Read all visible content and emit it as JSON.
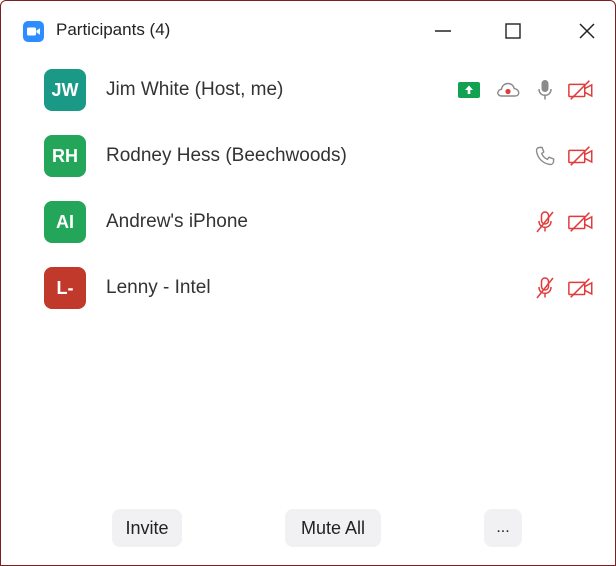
{
  "window": {
    "title": "Participants (4)",
    "app_icon": "zoom-camera-icon",
    "controls": [
      "minimize-icon",
      "maximize-icon",
      "close-icon"
    ]
  },
  "participants": [
    {
      "initials": "JW",
      "name": "Jim White (Host, me)",
      "avatar_color": "#1a9a86",
      "icons": [
        "share-screen-icon",
        "cloud-record-icon",
        "mic-icon",
        "video-off-icon"
      ]
    },
    {
      "initials": "RH",
      "name": "Rodney Hess (Beechwoods)",
      "avatar_color": "#23a65a",
      "icons": [
        "phone-icon",
        "video-off-icon"
      ]
    },
    {
      "initials": "AI",
      "name": "Andrew's iPhone",
      "avatar_color": "#23a65a",
      "icons": [
        "mic-muted-icon",
        "video-off-icon"
      ]
    },
    {
      "initials": "L-",
      "name": "Lenny - Intel",
      "avatar_color": "#c0392b",
      "icons": [
        "mic-muted-icon",
        "video-off-icon"
      ]
    }
  ],
  "footer": {
    "invite_label": "Invite",
    "mute_all_label": "Mute All",
    "more_label": "..."
  },
  "colors": {
    "accent": "#2d8cff",
    "muted_red": "#e23b3b",
    "share_green": "#12a150",
    "icon_gray": "#8a8a8a",
    "window_border": "#7b1f1f"
  }
}
